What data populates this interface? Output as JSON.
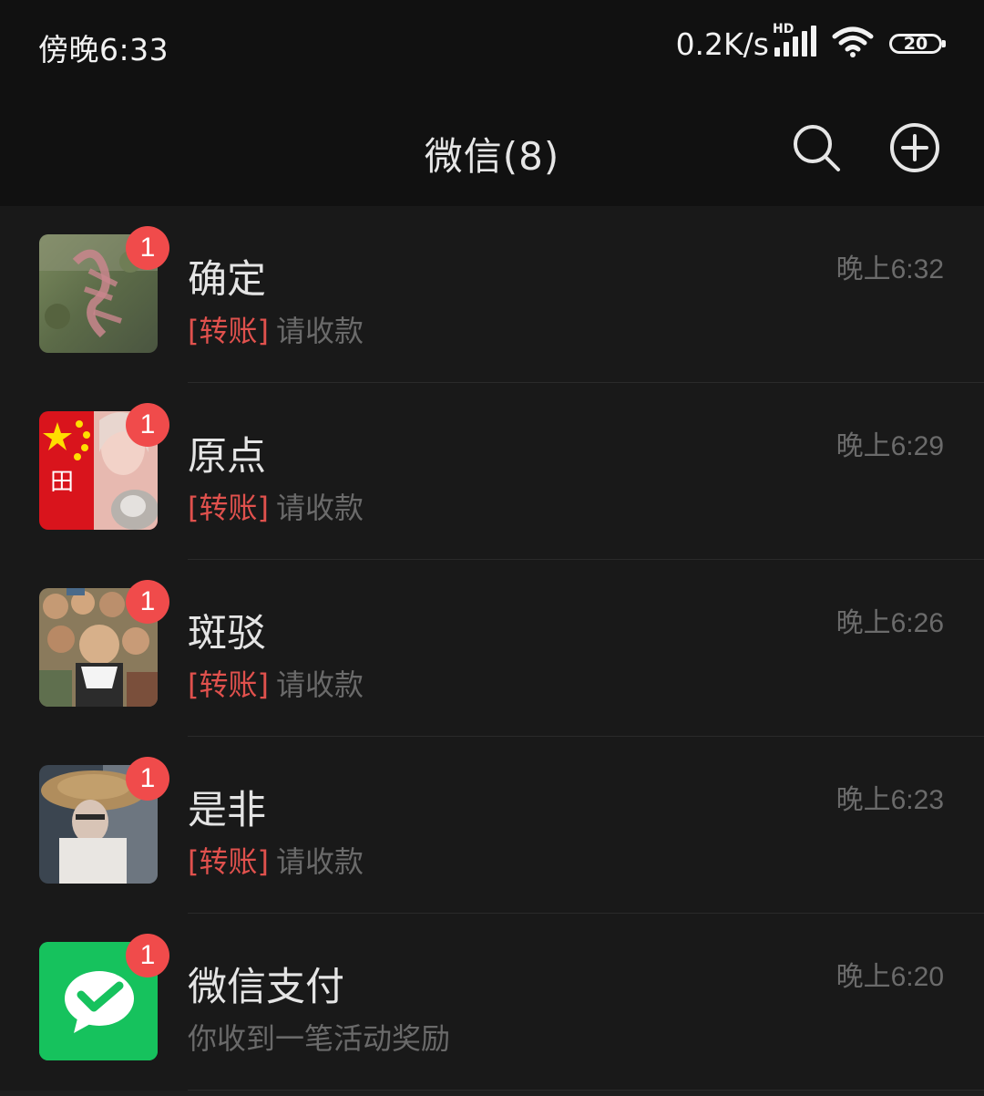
{
  "status_bar": {
    "time": "傍晚6:33",
    "net_speed": "0.2K/s",
    "signal_label": "HD",
    "battery": "20",
    "wifi_icon": "wifi-icon",
    "signal_icon": "signal-icon"
  },
  "nav": {
    "title": "微信(8)",
    "search_icon": "search-icon",
    "add_icon": "plus-circle-icon"
  },
  "colors": {
    "background": "#191919",
    "header": "#111111",
    "badge": "#f04b4b",
    "transfer_tag": "#e0514d",
    "wechat_pay_green": "#16c25d"
  },
  "chats": [
    {
      "name": "确定",
      "time": "晚上6:32",
      "tag": "[转账]",
      "preview": "请收款",
      "unread": "1",
      "avatar": "calligraphy-avatar"
    },
    {
      "name": "原点",
      "time": "晚上6:29",
      "tag": "[转账]",
      "preview": "请收款",
      "unread": "1",
      "avatar": "flag-cat-avatar"
    },
    {
      "name": "斑驳",
      "time": "晚上6:26",
      "tag": "[转账]",
      "preview": "请收款",
      "unread": "1",
      "avatar": "crowd-illustration-avatar"
    },
    {
      "name": "是非",
      "time": "晚上6:23",
      "tag": "[转账]",
      "preview": "请收款",
      "unread": "1",
      "avatar": "straw-hat-avatar"
    },
    {
      "name": "微信支付",
      "time": "晚上6:20",
      "tag": "",
      "preview": "你收到一笔活动奖励",
      "unread": "1",
      "avatar": "wechat-pay-icon"
    }
  ]
}
